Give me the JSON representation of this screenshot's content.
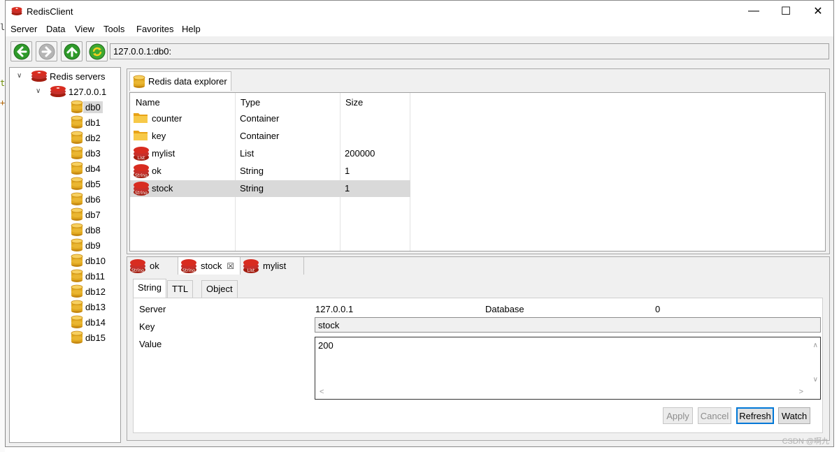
{
  "window": {
    "title": "RedisClient",
    "minimize": "—",
    "maximize": "☐",
    "close": "✕"
  },
  "menu": [
    "Server",
    "Data",
    "View",
    "Tools",
    "Favorites",
    "Help"
  ],
  "toolbar": {
    "address": "127.0.0.1:db0:"
  },
  "tree": {
    "root": "Redis servers",
    "server": "127.0.0.1",
    "databases": [
      "db0",
      "db1",
      "db2",
      "db3",
      "db4",
      "db5",
      "db6",
      "db7",
      "db8",
      "db9",
      "db10",
      "db11",
      "db12",
      "db13",
      "db14",
      "db15"
    ],
    "selected": "db0"
  },
  "explorer": {
    "tab_label": "Redis data explorer",
    "columns": [
      "Name",
      "Type",
      "Size"
    ],
    "rows": [
      {
        "name": "counter",
        "type": "Container",
        "size": "",
        "icon": "folder-icon"
      },
      {
        "name": "key",
        "type": "Container",
        "size": "",
        "icon": "folder-icon"
      },
      {
        "name": "mylist",
        "type": "List",
        "size": "200000",
        "icon": "redis-list-icon"
      },
      {
        "name": "ok",
        "type": "String",
        "size": "1",
        "icon": "redis-string-icon"
      },
      {
        "name": "stock",
        "type": "String",
        "size": "1",
        "icon": "redis-string-icon"
      }
    ]
  },
  "detail": {
    "tabs": [
      {
        "label": "ok",
        "icon": "redis-string-icon"
      },
      {
        "label": "stock",
        "icon": "redis-string-icon",
        "close": "☒"
      },
      {
        "label": "mylist",
        "icon": "redis-list-icon"
      }
    ],
    "subtabs": [
      "String",
      "TTL",
      "Object"
    ],
    "labels": {
      "server": "Server",
      "database": "Database",
      "key": "Key",
      "value": "Value"
    },
    "values": {
      "server": "127.0.0.1",
      "database": "0",
      "key": "stock",
      "value": "200"
    },
    "buttons": {
      "apply": "Apply",
      "cancel": "Cancel",
      "refresh": "Refresh",
      "watch": "Watch"
    }
  },
  "watermark": "CSDN @啊九"
}
